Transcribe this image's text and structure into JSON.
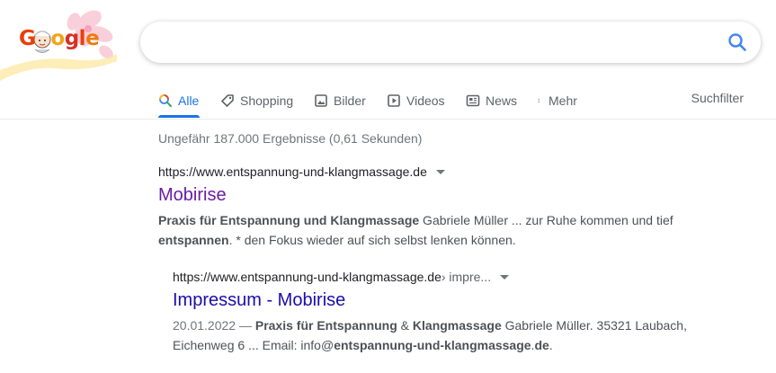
{
  "logo": {
    "text_letters": [
      "G",
      "o",
      "g",
      "l",
      "e"
    ],
    "colors": [
      "#e8400c",
      "#f0a419",
      "#d93025",
      "#e8400c",
      "#f07a10"
    ]
  },
  "search": {
    "value": "",
    "placeholder": "",
    "button_icon": "search-icon"
  },
  "tabs": [
    {
      "label": "Alle",
      "icon": "search-icon",
      "active": true
    },
    {
      "label": "Shopping",
      "icon": "tag-icon",
      "active": false
    },
    {
      "label": "Bilder",
      "icon": "image-icon",
      "active": false
    },
    {
      "label": "Videos",
      "icon": "play-icon",
      "active": false
    },
    {
      "label": "News",
      "icon": "news-icon",
      "active": false
    },
    {
      "label": "Mehr",
      "icon": "more-vert-icon",
      "active": false
    }
  ],
  "tools_label": "Suchfilter",
  "stats": "Ungefähr 187.000 Ergebnisse (0,61 Sekunden)",
  "results": [
    {
      "url": "https://www.entspannung-und-klangmassage.de",
      "breadcrumb": "",
      "title": "Mobirise",
      "snippet_parts": [
        {
          "bold": true,
          "text": "Praxis für Entspannung und Klangmassage"
        },
        {
          "bold": false,
          "text": " Gabriele Müller ... zur Ruhe kommen und tief "
        },
        {
          "bold": true,
          "text": "entspannen"
        },
        {
          "bold": false,
          "text": ". * den Fokus wieder auf sich selbst lenken können."
        }
      ]
    },
    {
      "url": "https://www.entspannung-und-klangmassage.de",
      "breadcrumb": " › impre...",
      "title": "Impressum - Mobirise",
      "date": "20.01.2022 — ",
      "snippet_parts": [
        {
          "bold": true,
          "text": "Praxis für Entspannung"
        },
        {
          "bold": false,
          "text": " & "
        },
        {
          "bold": true,
          "text": "Klangmassage"
        },
        {
          "bold": false,
          "text": " Gabriele Müller. 35321 Laubach, Eichenweg 6 ... Email: info@"
        },
        {
          "bold": true,
          "text": "entspannung-und-klangmassage"
        },
        {
          "bold": false,
          "text": "."
        },
        {
          "bold": true,
          "text": "de"
        },
        {
          "bold": false,
          "text": "."
        }
      ]
    }
  ],
  "colors": {
    "accent": "#1a73e8",
    "visited_link": "#681da8",
    "link": "#1a0dab"
  }
}
